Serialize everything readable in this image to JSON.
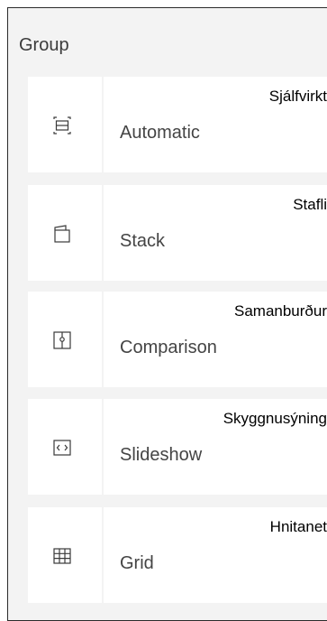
{
  "group": {
    "title": "Group"
  },
  "items": [
    {
      "label": "Automatic",
      "note": "Sjálfvirkt",
      "icon": "automatic-layout-icon"
    },
    {
      "label": "Stack",
      "note": "Stafli",
      "icon": "stack-icon"
    },
    {
      "label": "Comparison",
      "note": "Samanburður",
      "icon": "comparison-icon"
    },
    {
      "label": "Slideshow",
      "note": "Skyggnusýning",
      "icon": "slideshow-icon"
    },
    {
      "label": "Grid",
      "note": "Hnitanet",
      "icon": "grid-icon"
    }
  ],
  "colors": {
    "panel_background": "#f3f3f3",
    "tile_background": "#ffffff",
    "text": "#444444",
    "border": "#2b2b2b"
  }
}
